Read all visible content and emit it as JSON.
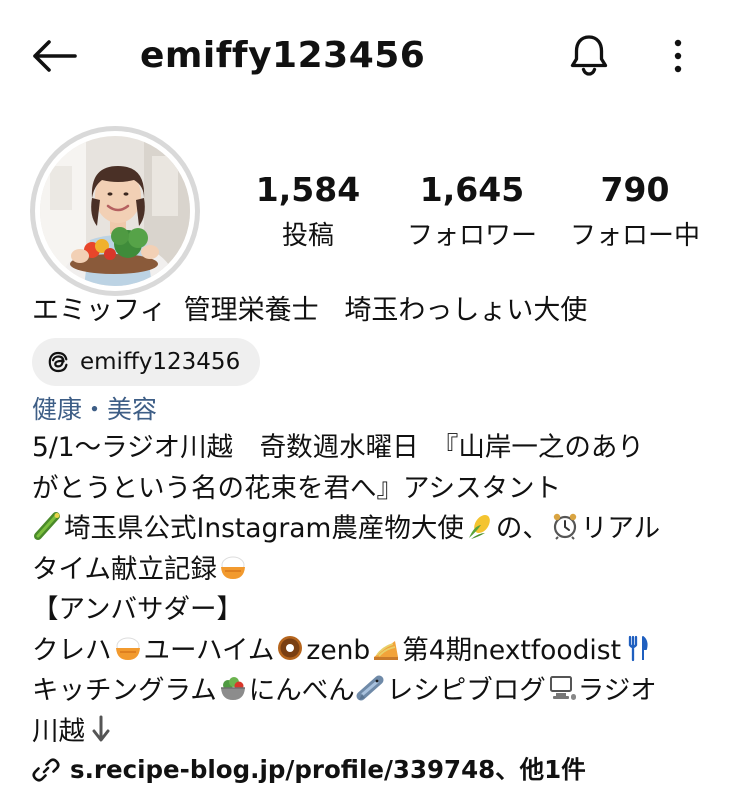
{
  "header": {
    "username": "emiffy123456",
    "icons": {
      "back": "arrow-left-icon",
      "notifications": "bell-icon",
      "more": "more-vertical-icon"
    }
  },
  "profile": {
    "avatar_icon": "profile-photo",
    "stats": [
      {
        "value": "1,584",
        "label": "投稿"
      },
      {
        "value": "1,645",
        "label": "フォロワー"
      },
      {
        "value": "790",
        "label": "フォロー中"
      }
    ],
    "display_name": "エミッフィ  管理栄養士   埼玉わっしょい大使",
    "threads": {
      "icon": "threads-icon",
      "handle": "emiffy123456"
    },
    "category": "健康・美容",
    "bio": {
      "line1": "5/1～ラジオ川越　奇数週水曜日　『山岸一之のあり",
      "line2": "がとうという名の花束を君へ』アシスタント",
      "line3a": "埼玉県公式Instagram農産物大使",
      "line3b": "の、",
      "line3c": "リアル",
      "line4": "タイム献立記録",
      "line5": "【アンバサダー】",
      "line6a": "クレハ",
      "line6b": "ユーハイム",
      "line6c": "zenb",
      "line6d": "第4期nextfoodist",
      "line7a": "キッチングラム",
      "line7b": "にんべん",
      "line7c": "レシピブログ",
      "line7d": "ラジオ",
      "line8": "川越"
    },
    "emoji_icons": [
      "cucumber-icon",
      "corn-icon",
      "alarm-clock-icon",
      "rice-bowl-icon",
      "donut-icon",
      "noodles-icon",
      "fork-knife-icon",
      "salad-icon",
      "fish-icon",
      "computer-icon",
      "down-arrow-icon"
    ],
    "link": {
      "icon": "link-icon",
      "text": "s.recipe-blog.jp/profile/339748、他1件"
    }
  },
  "colors": {
    "category": "#3e5e86",
    "chip_bg": "#efefef",
    "avatar_ring": "#d9d9d9",
    "text": "#111111"
  }
}
